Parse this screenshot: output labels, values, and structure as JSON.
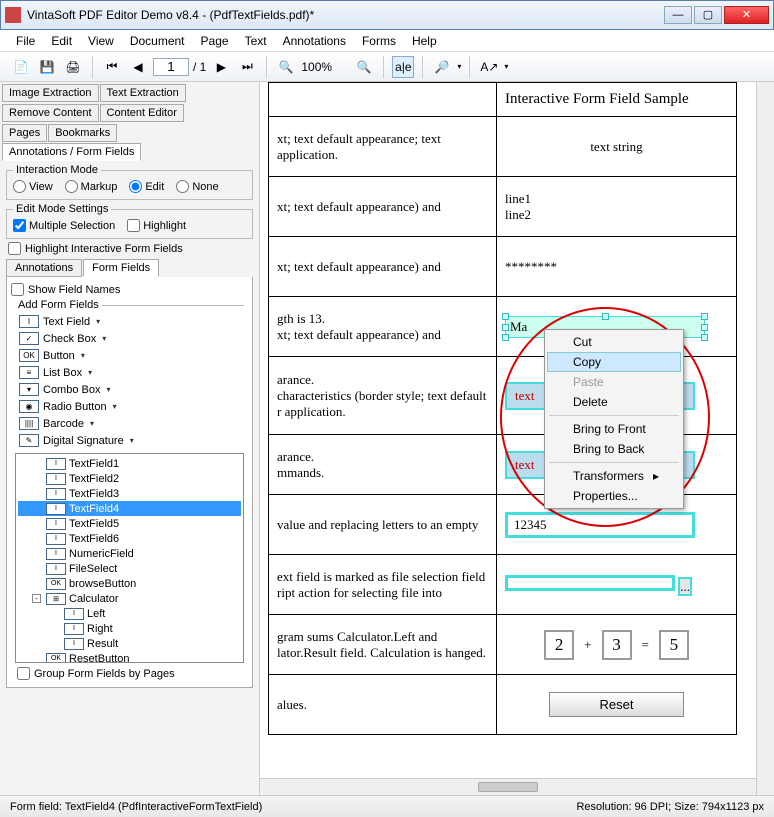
{
  "window": {
    "title": "VintaSoft PDF Editor Demo v8.4  -  (PdfTextFields.pdf)*"
  },
  "menu": [
    "File",
    "Edit",
    "View",
    "Document",
    "Page",
    "Text",
    "Annotations",
    "Forms",
    "Help"
  ],
  "toolbar": {
    "page_current": "1",
    "page_total": "/ 1",
    "zoom": "100%"
  },
  "left": {
    "tabs_row1": [
      "Image Extraction",
      "Text Extraction"
    ],
    "tabs_row2": [
      "Remove Content",
      "Content Editor"
    ],
    "tabs_row3": [
      "Pages",
      "Bookmarks",
      "Annotations / Form Fields"
    ],
    "interaction_legend": "Interaction Mode",
    "interaction_opts": [
      "View",
      "Markup",
      "Edit",
      "None"
    ],
    "editmode_legend": "Edit Mode Settings",
    "multi_sel": "Multiple Selection",
    "highlight": "Highlight",
    "highlight_fields": "Highlight Interactive Form  Fields",
    "subtabs": [
      "Annotations",
      "Form Fields"
    ],
    "show_field_names": "Show Field Names",
    "add_fields_legend": "Add Form Fields",
    "ffitems": [
      "Text Field",
      "Check Box",
      "Button",
      "List Box",
      "Combo Box",
      "Radio Button",
      "Barcode",
      "Digital Signature"
    ],
    "tree": [
      "TextField1",
      "TextField2",
      "TextField3",
      "TextField4",
      "TextField5",
      "TextField6",
      "NumericField",
      "FileSelect",
      "browseButton",
      "Calculator",
      "Left",
      "Right",
      "Result",
      "ResetButton"
    ],
    "group_by_pages": "Group Form Fields by Pages"
  },
  "doc": {
    "header_col2": "Interactive Form Field Sample",
    "rows": [
      {
        "c1": "xt; text default appearance; text application.",
        "c2": "text string"
      },
      {
        "c1": "xt; text default appearance) and",
        "c2": "line1\nline2"
      },
      {
        "c1": "xt; text default appearance) and",
        "c2": "********"
      },
      {
        "c1": "gth is 13.\nxt; text default appearance) and",
        "c2": "Ma"
      },
      {
        "c1": "arance.\ncharacteristics (border style; text default r application.",
        "c2": "text"
      },
      {
        "c1": "arance.\nmmands.",
        "c2": "text"
      },
      {
        "c1": "value and replacing letters to an empty",
        "c2": "12345"
      },
      {
        "c1": "ext field is marked as file selection field ript action for selecting file into",
        "c2": ""
      },
      {
        "c1": "gram sums Calculator.Left and lator.Result field. Calculation is hanged.",
        "c2calc": {
          "a": "2",
          "op1": "+",
          "b": "3",
          "op2": "=",
          "r": "5"
        }
      },
      {
        "c1": "alues.",
        "c2btn": "Reset"
      }
    ]
  },
  "ctx": {
    "items": [
      "Cut",
      "Copy",
      "Paste",
      "Delete",
      "Bring to Front",
      "Bring to Back",
      "Transformers",
      "Properties..."
    ]
  },
  "status": {
    "left": "Form field: TextField4 (PdfInteractiveFormTextField)",
    "right": "Resolution: 96 DPI; Size: 794x1123 px"
  }
}
